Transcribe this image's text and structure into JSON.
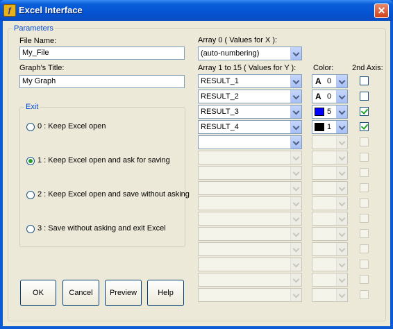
{
  "window": {
    "title": "Excel Interface",
    "app_icon": "excel-interface-icon"
  },
  "parameters": {
    "legend": "Parameters",
    "file_name_label": "File Name:",
    "file_name_value": "My_File",
    "graph_title_label": "Graph's Title:",
    "graph_title_value": "My Graph"
  },
  "exit": {
    "legend": "Exit",
    "selected_index": 1,
    "options": [
      "0 : Keep Excel open",
      "1 : Keep Excel open and ask for saving",
      "2 : Keep Excel open and save without asking",
      "3 : Save without asking and exit Excel"
    ]
  },
  "buttons": {
    "ok": "OK",
    "cancel": "Cancel",
    "preview": "Preview",
    "help": "Help"
  },
  "array_x": {
    "label": "Array 0 ( Values for X ):",
    "value": "(auto-numbering)"
  },
  "array_y": {
    "label": "Array 1 to 15 ( Values for Y ):",
    "color_label": "Color:",
    "axis_label": "2nd Axis:",
    "rows": [
      {
        "value": "RESULT_1",
        "enabled": true,
        "color_enabled": true,
        "color_kind": "text",
        "color_glyph": "A",
        "color_hex": "",
        "color_num": "0",
        "second_axis": false
      },
      {
        "value": "RESULT_2",
        "enabled": true,
        "color_enabled": true,
        "color_kind": "text",
        "color_glyph": "A",
        "color_hex": "",
        "color_num": "0",
        "second_axis": false
      },
      {
        "value": "RESULT_3",
        "enabled": true,
        "color_enabled": true,
        "color_kind": "swatch",
        "color_glyph": "",
        "color_hex": "#0000ff",
        "color_num": "5",
        "second_axis": true
      },
      {
        "value": "RESULT_4",
        "enabled": true,
        "color_enabled": true,
        "color_kind": "swatch",
        "color_glyph": "",
        "color_hex": "#000000",
        "color_num": "1",
        "second_axis": true
      },
      {
        "value": "",
        "enabled": true,
        "color_enabled": false,
        "color_kind": "none",
        "color_glyph": "",
        "color_hex": "",
        "color_num": "",
        "second_axis": false
      },
      {
        "value": "",
        "enabled": false,
        "color_enabled": false,
        "color_kind": "none",
        "color_glyph": "",
        "color_hex": "",
        "color_num": "",
        "second_axis": false
      },
      {
        "value": "",
        "enabled": false,
        "color_enabled": false,
        "color_kind": "none",
        "color_glyph": "",
        "color_hex": "",
        "color_num": "",
        "second_axis": false
      },
      {
        "value": "",
        "enabled": false,
        "color_enabled": false,
        "color_kind": "none",
        "color_glyph": "",
        "color_hex": "",
        "color_num": "",
        "second_axis": false
      },
      {
        "value": "",
        "enabled": false,
        "color_enabled": false,
        "color_kind": "none",
        "color_glyph": "",
        "color_hex": "",
        "color_num": "",
        "second_axis": false
      },
      {
        "value": "",
        "enabled": false,
        "color_enabled": false,
        "color_kind": "none",
        "color_glyph": "",
        "color_hex": "",
        "color_num": "",
        "second_axis": false
      },
      {
        "value": "",
        "enabled": false,
        "color_enabled": false,
        "color_kind": "none",
        "color_glyph": "",
        "color_hex": "",
        "color_num": "",
        "second_axis": false
      },
      {
        "value": "",
        "enabled": false,
        "color_enabled": false,
        "color_kind": "none",
        "color_glyph": "",
        "color_hex": "",
        "color_num": "",
        "second_axis": false
      },
      {
        "value": "",
        "enabled": false,
        "color_enabled": false,
        "color_kind": "none",
        "color_glyph": "",
        "color_hex": "",
        "color_num": "",
        "second_axis": false
      },
      {
        "value": "",
        "enabled": false,
        "color_enabled": false,
        "color_kind": "none",
        "color_glyph": "",
        "color_hex": "",
        "color_num": "",
        "second_axis": false
      },
      {
        "value": "",
        "enabled": false,
        "color_enabled": false,
        "color_kind": "none",
        "color_glyph": "",
        "color_hex": "",
        "color_num": "",
        "second_axis": false
      }
    ]
  }
}
